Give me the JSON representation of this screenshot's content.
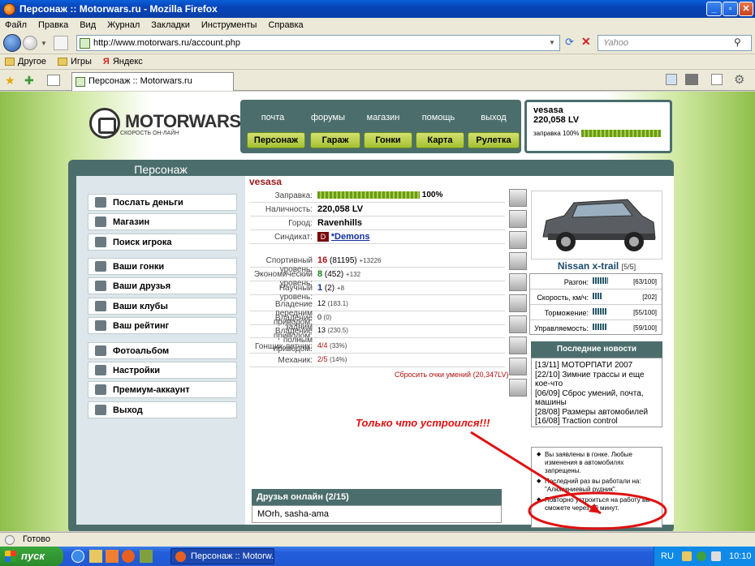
{
  "window": {
    "title": "Персонаж :: Motorwars.ru - Mozilla Firefox"
  },
  "menu": [
    "Файл",
    "Правка",
    "Вид",
    "Журнал",
    "Закладки",
    "Инструменты",
    "Справка"
  ],
  "address": {
    "url": "http://www.motorwars.ru/account.php",
    "search_placeholder": "Yahoo"
  },
  "bookmarks": [
    "Другое",
    "Игры",
    "Яндекс"
  ],
  "tab": {
    "title": "Персонаж :: Motorwars.ru"
  },
  "site": {
    "logo": "MOTORWARS.RU",
    "logo_sub": "СКОРОСТЬ ОН-ЛАЙН",
    "top_links": [
      "почта",
      "форумы",
      "магазин",
      "помощь",
      "выход"
    ],
    "top_buttons": [
      "Персонаж",
      "Гараж",
      "Гонки",
      "Карта",
      "Рулетка"
    ],
    "user": {
      "name": "vesasa",
      "money": "220,058 LV",
      "fuel_label": "заправка 100%",
      "fuel_percent": 100
    }
  },
  "sidebar": {
    "title": "Персонаж",
    "items": [
      "Послать деньги",
      "Магазин",
      "Поиск игрока",
      "Ваши гонки",
      "Ваши друзья",
      "Ваши клубы",
      "Ваш рейтинг",
      "Фотоальбом",
      "Настройки",
      "Премиум-аккаунт",
      "Выход"
    ]
  },
  "profile": {
    "nick": "vesasa",
    "fuel_label": "Заправка:",
    "fuel_value": "100%",
    "cash_label": "Наличность:",
    "cash_value": "220,058 LV",
    "city_label": "Город:",
    "city_value": "Ravenhills",
    "syndicate_label": "Синдикат:",
    "syndicate_value": "*Demons",
    "syndicate_badge": "D",
    "sport_label": "Спортивный уровень:",
    "sport_level": "16",
    "sport_points": "(81195)",
    "sport_delta": "+13226",
    "econ_label": "Экономический уровень:",
    "econ_level": "8",
    "econ_points": "(452)",
    "econ_delta": "+132",
    "sci_label": "Научный уровень:",
    "sci_level": "1",
    "sci_points": "(2)",
    "sci_delta": "+8",
    "fwd_label": "Владение передним приводом:",
    "fwd_value": "12",
    "fwd_extra": "(183.1)",
    "rwd_label": "Владение задним приводом:",
    "rwd_value": "0",
    "rwd_extra": "(0)",
    "awd_label": "Владение полным приводом:",
    "awd_value": "13",
    "awd_extra": "(230.5)",
    "pilot_label": "Гонщик-летчик:",
    "pilot_value": "4/4",
    "pilot_extra": "(33%)",
    "mech_label": "Механик:",
    "mech_value": "2/5",
    "mech_extra": "(14%)",
    "reset_link": "Сбросить очки умений (20,347LV)"
  },
  "car": {
    "name": "Nissan x-trail",
    "grade": "[5/5]",
    "specs": [
      {
        "label": "Разгон:",
        "value": "[63/100]",
        "fill": 0.63
      },
      {
        "label": "Скорость, км/ч:",
        "value": "[202]",
        "fill": 0.4
      },
      {
        "label": "Торможение:",
        "value": "[55/100]",
        "fill": 0.55
      },
      {
        "label": "Управляемость:",
        "value": "[59/100]",
        "fill": 0.59
      }
    ]
  },
  "news": {
    "title": "Последние новости",
    "items": [
      "[13/11] МОТОРПАТИ 2007",
      "[22/10] Зимние трассы и еще кое-что",
      "[06/09] Сброс умений, почта, машины",
      "[28/08] Размеры автомобилей",
      "[16/08] Traction control"
    ]
  },
  "annotation": "Только что устроился!!!",
  "friends": {
    "title": "Друзья онлайн (2/15)",
    "list": "MOrh, sasha-ama"
  },
  "notices": [
    "Вы заявлены в гонке. Любые изменения в автомобилях запрещены.",
    "Последний раз вы работали на: \"Алюминиевый рудник\".",
    "Повторно устроиться на работу вы сможете через 60 минут."
  ],
  "status": {
    "text": "Готово"
  },
  "taskbar": {
    "start": "пуск",
    "task": "Персонаж :: Motorw...",
    "lang": "RU",
    "time": "10:10"
  }
}
